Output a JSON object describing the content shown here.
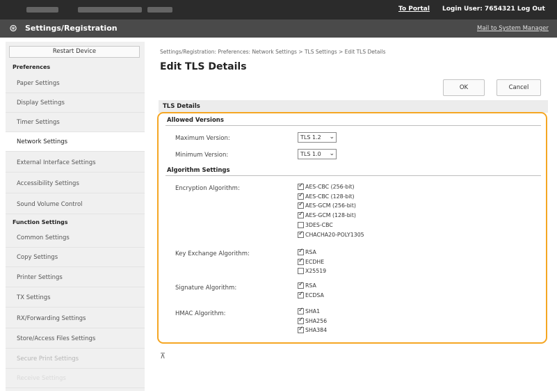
{
  "topbar": {
    "portal": "To Portal",
    "login": "Login User: 7654321  Log Out"
  },
  "header": {
    "title": "Settings/Registration",
    "mail_link": "Mail to System Manager"
  },
  "sidebar": {
    "restart": "Restart Device",
    "preferences_head": "Preferences",
    "preferences": [
      {
        "label": "Paper Settings"
      },
      {
        "label": "Display Settings"
      },
      {
        "label": "Timer Settings"
      },
      {
        "label": "Network Settings"
      },
      {
        "label": "External Interface Settings"
      },
      {
        "label": "Accessibility Settings"
      },
      {
        "label": "Sound Volume Control"
      }
    ],
    "function_head": "Function Settings",
    "function": [
      {
        "label": "Common Settings"
      },
      {
        "label": "Copy Settings"
      },
      {
        "label": "Printer Settings"
      },
      {
        "label": "TX Settings"
      },
      {
        "label": "RX/Forwarding Settings"
      },
      {
        "label": "Store/Access Files Settings"
      },
      {
        "label": "Secure Print Settings"
      },
      {
        "label": "Receive Settings"
      }
    ]
  },
  "main": {
    "breadcrumb": "Settings/Registration: Preferences: Network Settings > TLS Settings > Edit TLS Details",
    "title": "Edit TLS Details",
    "ok": "OK",
    "cancel": "Cancel",
    "details_head": "TLS Details",
    "allowed_head": "Allowed Versions",
    "max_label": "Maximum Version:",
    "max_value": "TLS 1.2",
    "min_label": "Minimum Version:",
    "min_value": "TLS 1.0",
    "algo_head": "Algorithm Settings",
    "enc_label": "Encryption Algorithm:",
    "enc": [
      {
        "label": "AES-CBC (256-bit)",
        "checked": true
      },
      {
        "label": "AES-CBC (128-bit)",
        "checked": true
      },
      {
        "label": "AES-GCM (256-bit)",
        "checked": true
      },
      {
        "label": "AES-GCM (128-bit)",
        "checked": true
      },
      {
        "label": "3DES-CBC",
        "checked": false
      },
      {
        "label": "CHACHA20-POLY1305",
        "checked": true
      }
    ],
    "kex_label": "Key Exchange Algorithm:",
    "kex": [
      {
        "label": "RSA",
        "checked": true
      },
      {
        "label": "ECDHE",
        "checked": true
      },
      {
        "label": "X25519",
        "checked": false
      }
    ],
    "sig_label": "Signature Algorithm:",
    "sig": [
      {
        "label": "RSA",
        "checked": true
      },
      {
        "label": "ECDSA",
        "checked": true
      }
    ],
    "hmac_label": "HMAC Algorithm:",
    "hmac": [
      {
        "label": "SHA1",
        "checked": true
      },
      {
        "label": "SHA256",
        "checked": true
      },
      {
        "label": "SHA384",
        "checked": true
      }
    ],
    "back_glyph": "⊼"
  },
  "colors": {
    "highlight": "#f5a623",
    "topbar": "#2b2b2b",
    "header": "#4a4a4a"
  }
}
